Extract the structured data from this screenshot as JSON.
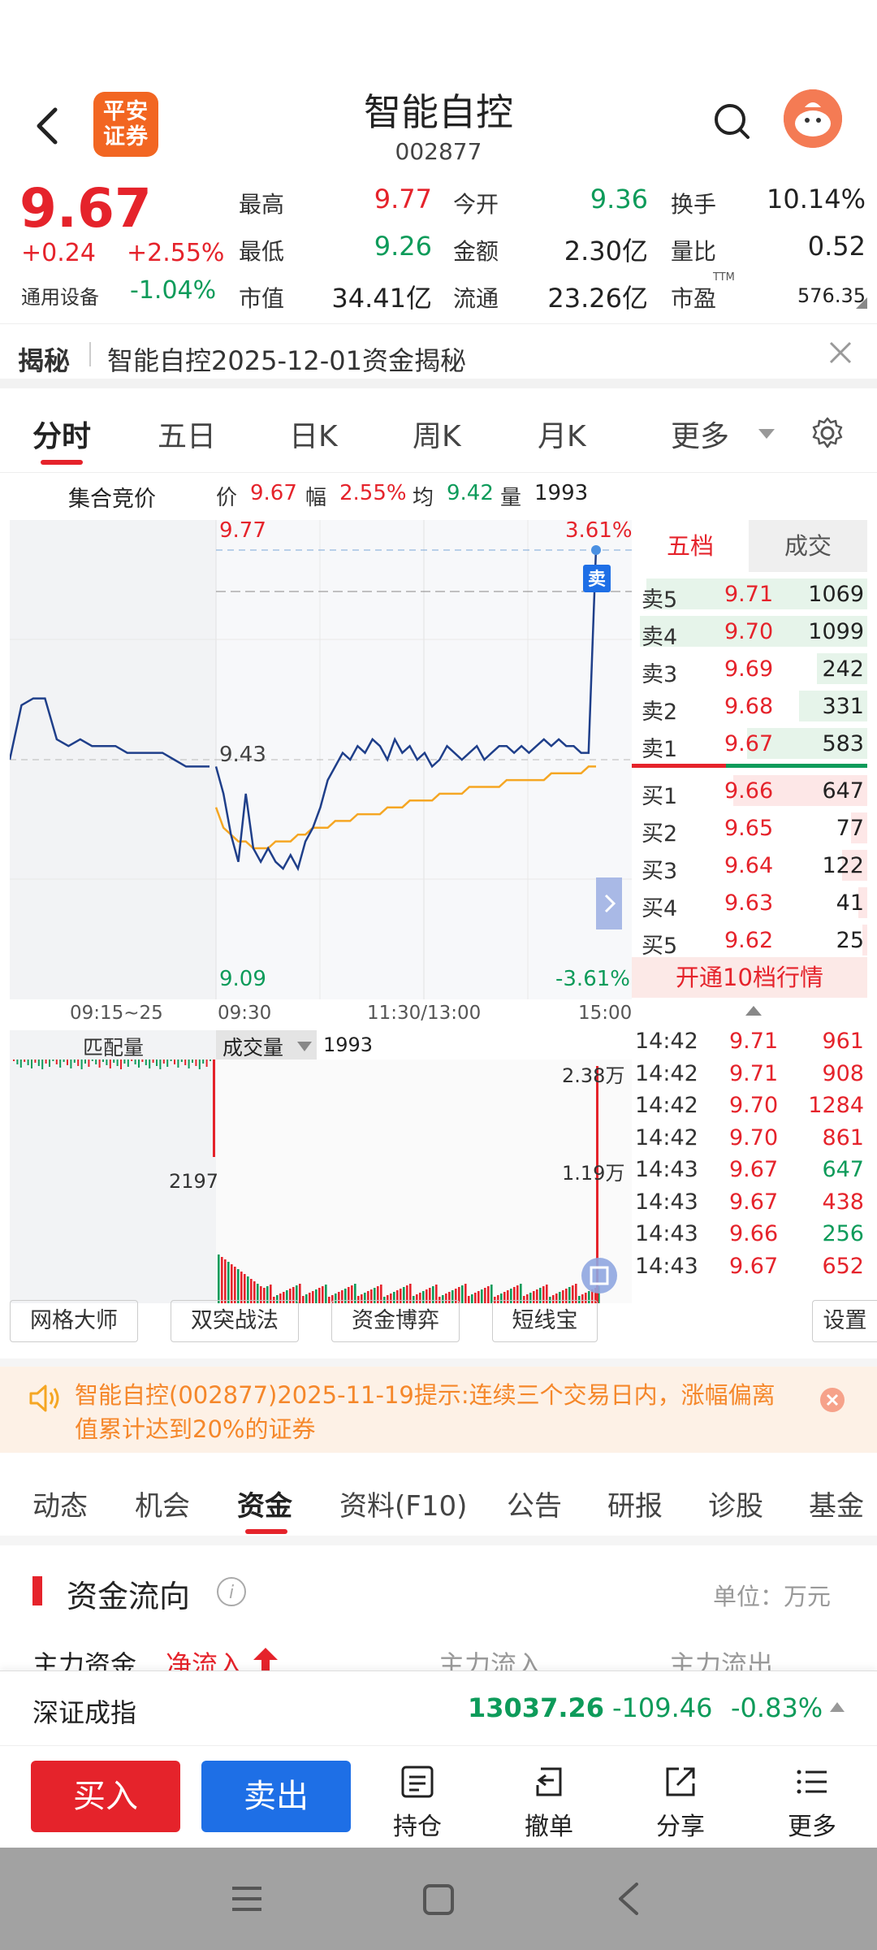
{
  "header": {
    "title": "智能自控",
    "code": "002877",
    "logo_line1": "平安",
    "logo_line2": "证券"
  },
  "quote": {
    "price": "9.67",
    "change": "+0.24",
    "change_pct": "+2.55%",
    "industry": "通用设备",
    "industry_pct": "-1.04%",
    "high_label": "最高",
    "high": "9.77",
    "open_label": "今开",
    "open": "9.36",
    "turnover_label": "换手",
    "turnover": "10.14%",
    "low_label": "最低",
    "low": "9.26",
    "amount_label": "金额",
    "amount": "2.30亿",
    "vr_label": "量比",
    "vr": "0.52",
    "mcap_label": "市值",
    "mcap": "34.41亿",
    "float_label": "流通",
    "float": "23.26亿",
    "pe_label": "市盈",
    "pe_sup": "TTM",
    "pe": "576.35"
  },
  "reveal": {
    "label": "揭秘",
    "text": "智能自控2025-12-01资金揭秘"
  },
  "tabs": [
    "分时",
    "五日",
    "日K",
    "周K",
    "月K",
    "更多"
  ],
  "chart_info": {
    "auction": "集合竞价",
    "price_label": "价",
    "price": "9.67",
    "amp_label": "幅",
    "amp": "2.55%",
    "avg_label": "均",
    "avg": "9.42",
    "vol_label": "量",
    "vol": "1993"
  },
  "chart_data": {
    "type": "line",
    "top_price": "9.77",
    "top_pct": "3.61%",
    "mid_price": "9.43",
    "bottom_price": "9.09",
    "bottom_pct": "-3.61%",
    "ylim": [
      9.09,
      9.77
    ],
    "x_ticks": [
      "09:15~25",
      "09:30",
      "11:30/13:00",
      "15:00"
    ],
    "pre_series": [
      9.43,
      9.51,
      9.52,
      9.52,
      9.46,
      9.45,
      9.46,
      9.45,
      9.45,
      9.45,
      9.44,
      9.44,
      9.44,
      9.44,
      9.43,
      9.42,
      9.42,
      9.42
    ],
    "series": [
      {
        "name": "价",
        "values": [
          9.42,
          9.38,
          9.32,
          9.28,
          9.38,
          9.3,
          9.28,
          9.3,
          9.28,
          9.27,
          9.29,
          9.27,
          9.31,
          9.33,
          9.36,
          9.4,
          9.42,
          9.44,
          9.43,
          9.45,
          9.44,
          9.46,
          9.45,
          9.43,
          9.46,
          9.44,
          9.45,
          9.43,
          9.44,
          9.42,
          9.43,
          9.45,
          9.44,
          9.43,
          9.44,
          9.45,
          9.43,
          9.44,
          9.45,
          9.45,
          9.44,
          9.45,
          9.44,
          9.45,
          9.46,
          9.45,
          9.46,
          9.45,
          9.45,
          9.44,
          9.44,
          9.74
        ]
      },
      {
        "name": "均",
        "values": [
          9.36,
          9.33,
          9.32,
          9.31,
          9.31,
          9.3,
          9.3,
          9.3,
          9.31,
          9.31,
          9.31,
          9.32,
          9.32,
          9.33,
          9.33,
          9.33,
          9.34,
          9.34,
          9.34,
          9.35,
          9.35,
          9.35,
          9.35,
          9.36,
          9.36,
          9.36,
          9.37,
          9.37,
          9.37,
          9.37,
          9.38,
          9.38,
          9.38,
          9.38,
          9.39,
          9.39,
          9.39,
          9.39,
          9.39,
          9.4,
          9.4,
          9.4,
          9.4,
          9.4,
          9.4,
          9.41,
          9.41,
          9.41,
          9.41,
          9.41,
          9.42,
          9.42
        ]
      }
    ],
    "sell_marker": "卖"
  },
  "orderbook": {
    "tab_active": "五档",
    "tab_other": "成交",
    "asks": [
      {
        "label": "卖5",
        "price": "9.71",
        "vol": "1069",
        "frac": 0.97
      },
      {
        "label": "卖4",
        "price": "9.70",
        "vol": "1099",
        "frac": 1.0
      },
      {
        "label": "卖3",
        "price": "9.69",
        "vol": "242",
        "frac": 0.22
      },
      {
        "label": "卖2",
        "price": "9.68",
        "vol": "331",
        "frac": 0.3
      },
      {
        "label": "卖1",
        "price": "9.67",
        "vol": "583",
        "frac": 0.53
      }
    ],
    "bids": [
      {
        "label": "买1",
        "price": "9.66",
        "vol": "647",
        "frac": 0.59
      },
      {
        "label": "买2",
        "price": "9.65",
        "vol": "77",
        "frac": 0.07
      },
      {
        "label": "买3",
        "price": "9.64",
        "vol": "122",
        "frac": 0.11
      },
      {
        "label": "买4",
        "price": "9.63",
        "vol": "41",
        "frac": 0.04
      },
      {
        "label": "买5",
        "price": "9.62",
        "vol": "25",
        "frac": 0.02
      }
    ],
    "open10": "开通10档行情"
  },
  "ticks": [
    {
      "t": "14:42",
      "p": "9.71",
      "v": "961",
      "c": "red"
    },
    {
      "t": "14:42",
      "p": "9.71",
      "v": "908",
      "c": "red"
    },
    {
      "t": "14:42",
      "p": "9.70",
      "v": "1284",
      "c": "red"
    },
    {
      "t": "14:42",
      "p": "9.70",
      "v": "861",
      "c": "red"
    },
    {
      "t": "14:43",
      "p": "9.67",
      "v": "647",
      "c": "green"
    },
    {
      "t": "14:43",
      "p": "9.67",
      "v": "438",
      "c": "red"
    },
    {
      "t": "14:43",
      "p": "9.66",
      "v": "256",
      "c": "green"
    },
    {
      "t": "14:43",
      "p": "9.67",
      "v": "652",
      "c": "red"
    }
  ],
  "volume": {
    "match_label": "匹配量",
    "vol_label": "成交量",
    "vol_value": "1993",
    "max": "2.38万",
    "mid": "1.19万",
    "auction_val": "2197"
  },
  "tools": [
    "网格大师",
    "双突战法",
    "资金博弈",
    "短线宝",
    "设置"
  ],
  "notice": {
    "text": "智能自控(002877)2025-11-19提示:连续三个交易日内，涨幅偏离值累计达到20%的证券"
  },
  "subtabs": [
    "动态",
    "机会",
    "资金",
    "资料(F10)",
    "公告",
    "研报",
    "诊股",
    "基金"
  ],
  "flow": {
    "title": "资金流向",
    "unit": "单位：万元",
    "main": "主力资金",
    "net": "净流入",
    "inflow": "主力流入",
    "outflow": "主力流出"
  },
  "index": {
    "name": "深证成指",
    "value": "13037.26",
    "change": "-109.46",
    "pct": "-0.83%"
  },
  "bottom": {
    "buy": "买入",
    "sell": "卖出",
    "hold": "持仓",
    "cancel": "撤单",
    "share": "分享",
    "more": "更多"
  },
  "colors": {
    "up": "#e5232b",
    "down": "#0d9b5a",
    "accent": "#1e6fe6",
    "price_line": "#1f3f8a",
    "avg_line": "#f5a623"
  }
}
